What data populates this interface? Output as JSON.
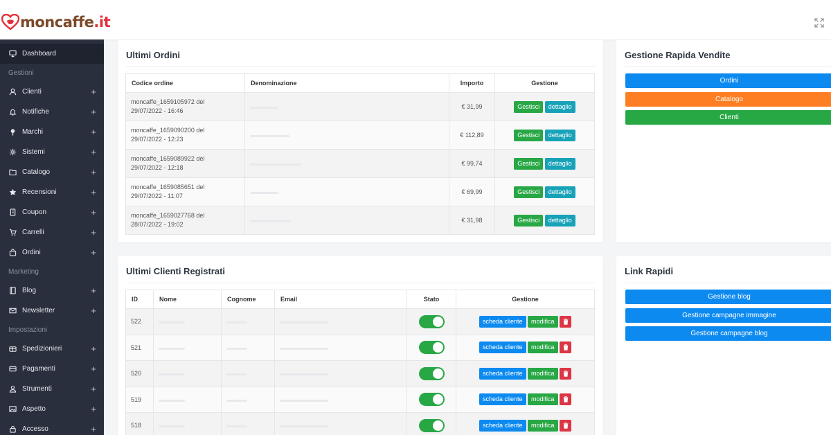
{
  "brand": {
    "name": "moncaffe",
    "tld": ".it"
  },
  "sidebar": {
    "dashboard": "Dashboard",
    "section_gestioni": "Gestioni",
    "gestioni": [
      {
        "label": "Clienti",
        "icon": "user-icon"
      },
      {
        "label": "Notifiche",
        "icon": "bell-icon"
      },
      {
        "label": "Marchi",
        "icon": "pin-icon"
      },
      {
        "label": "Sistemi",
        "icon": "cog-icon"
      },
      {
        "label": "Catalogo",
        "icon": "folder-icon"
      },
      {
        "label": "Recensioni",
        "icon": "star-icon"
      },
      {
        "label": "Coupon",
        "icon": "tag-icon"
      },
      {
        "label": "Carrelli",
        "icon": "cart-icon"
      },
      {
        "label": "Ordini",
        "icon": "bag-icon"
      }
    ],
    "section_marketing": "Marketing",
    "marketing": [
      {
        "label": "Blog",
        "icon": "book-icon"
      },
      {
        "label": "Newsletter",
        "icon": "mail-icon"
      }
    ],
    "section_impostazioni": "Impostazioni",
    "impostazioni": [
      {
        "label": "Spedizionieri",
        "icon": "box-icon"
      },
      {
        "label": "Pagamenti",
        "icon": "card-icon"
      },
      {
        "label": "Strumenti",
        "icon": "tools-icon"
      },
      {
        "label": "Aspetto",
        "icon": "image-icon"
      },
      {
        "label": "Accesso",
        "icon": "lock-icon"
      }
    ],
    "plus": "+"
  },
  "orders": {
    "title": "Ultimi Ordini",
    "headers": [
      "Codice ordine",
      "Denominazione",
      "Importo",
      "Gestione"
    ],
    "rows": [
      {
        "code": "moncaffe_1659105972 del",
        "date": "29/07/2022 - 16:46",
        "amount": "€ 31,99"
      },
      {
        "code": "moncaffe_1659090200 del",
        "date": "29/07/2022 - 12:23",
        "amount": "€ 112,89"
      },
      {
        "code": "moncaffe_1659089922 del",
        "date": "29/07/2022 - 12:18",
        "amount": "€ 99,74"
      },
      {
        "code": "moncaffe_1659085651 del",
        "date": "29/07/2022 - 11:07",
        "amount": "€ 69,99"
      },
      {
        "code": "moncaffe_1659027768 del",
        "date": "28/07/2022 - 19:02",
        "amount": "€ 31,98"
      }
    ],
    "btn_manage": "Gestisci",
    "btn_detail": "dettaglio"
  },
  "clients": {
    "title": "Ultimi Clienti Registrati",
    "headers": [
      "ID",
      "Nome",
      "Cognome",
      "Email",
      "Stato",
      "Gestione"
    ],
    "rows": [
      {
        "id": "522",
        "active": true
      },
      {
        "id": "521",
        "active": true
      },
      {
        "id": "520",
        "active": true
      },
      {
        "id": "519",
        "active": true
      },
      {
        "id": "518",
        "active": true
      }
    ],
    "btn_card": "scheda cliente",
    "btn_edit": "modifica"
  },
  "quick_sales": {
    "title": "Gestione Rapida Vendite",
    "buttons": [
      {
        "label": "Ordini",
        "color": "#0d8af0"
      },
      {
        "label": "Catalogo",
        "color": "#fd7e23"
      },
      {
        "label": "Clienti",
        "color": "#28a745"
      }
    ]
  },
  "quick_links": {
    "title": "Link Rapidi",
    "buttons": [
      {
        "label": "Gestione blog",
        "color": "#0d8af0"
      },
      {
        "label": "Gestione campagne immagine",
        "color": "#0d8af0"
      },
      {
        "label": "Gestione campagne blog",
        "color": "#0d8af0"
      }
    ]
  }
}
